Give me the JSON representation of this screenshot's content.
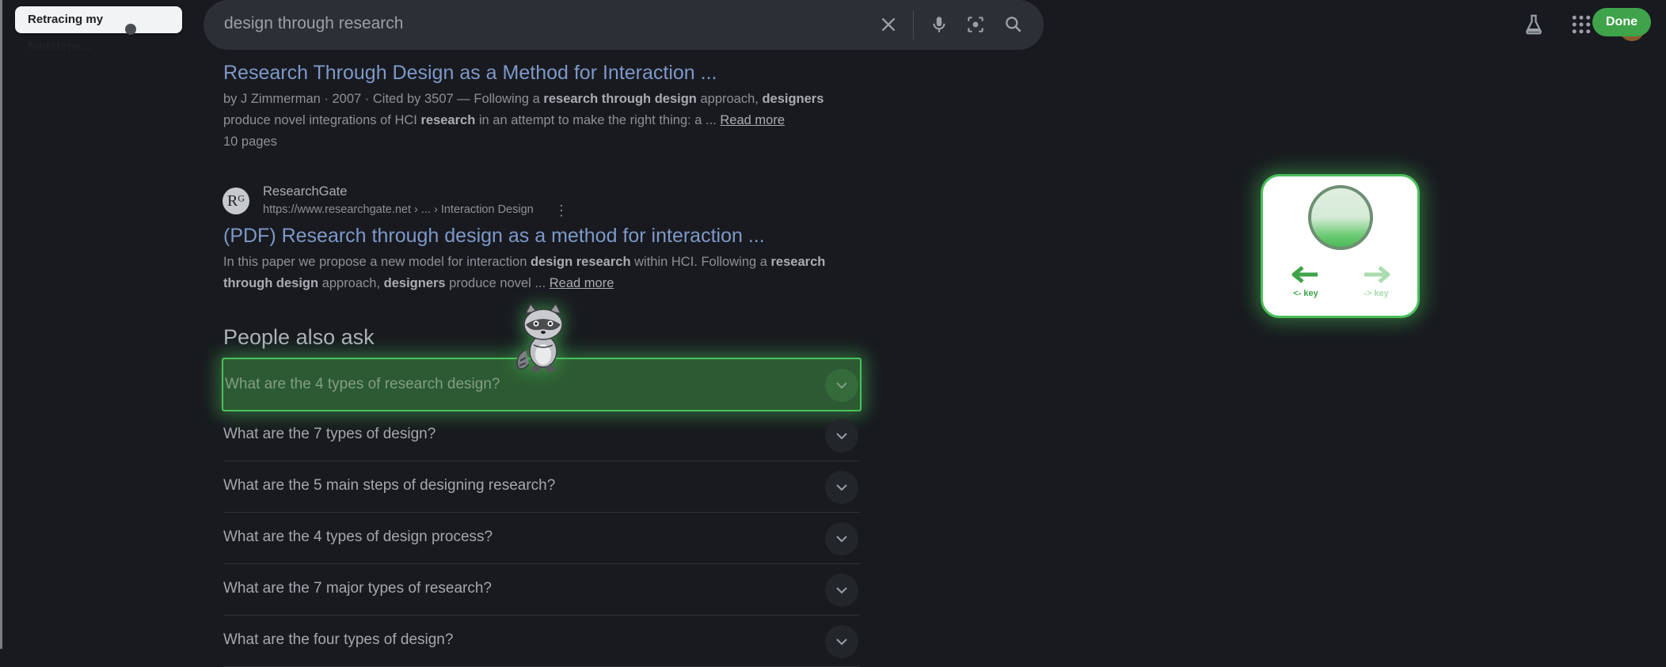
{
  "overlay": {
    "retrace_label": "Retracing my footsteps...",
    "done_label": "Done"
  },
  "search": {
    "query": "design through research",
    "clear_icon": "close-icon",
    "voice_icon": "microphone-icon",
    "lens_icon": "lens-icon",
    "search_icon": "search-icon"
  },
  "header": {
    "labs_icon": "flask-icon",
    "apps_icon": "apps-grid-icon"
  },
  "results": [
    {
      "title": "Research Through Design as a Method for Interaction ...",
      "meta": "by J Zimmerman · 2007 · Cited by 3507 — Following a ",
      "meta_b1": "research through design",
      "meta_mid": " approach, ",
      "meta_b2": "designers",
      "line2_pre": "produce novel integrations of HCI ",
      "line2_b": "research",
      "line2_post": " in an attempt to make the right thing: a ... ",
      "read_more": "Read more",
      "pages": "10 pages"
    },
    {
      "site_name": "ResearchGate",
      "favicon_text": "Rᴳ",
      "url": "https://www.researchgate.net › ... › Interaction Design",
      "menu": "⋮",
      "title": "(PDF) Research through design as a method for interaction ...",
      "line1_pre": "In this paper we propose a new model for interaction ",
      "line1_b1": "design research",
      "line1_mid": " within HCI. Following a ",
      "line1_b2": "research",
      "line2_b1": "through design",
      "line2_mid": " approach, ",
      "line2_b2": "designers",
      "line2_post": " produce novel ... ",
      "read_more": "Read more"
    }
  ],
  "people_also_ask": {
    "heading": "People also ask",
    "questions": [
      "What are the 4 types of research design?",
      "What are the 7 types of design?",
      "What are the 5 main steps of designing research?",
      "What are the 4 types of design process?",
      "What are the 7 major types of research?",
      "What are the four types of design?"
    ],
    "highlighted_index": 0
  },
  "nav_widget": {
    "back_key": "<- key",
    "forward_key": "-> key",
    "active_color": "#3fa34a",
    "inactive_color": "#a9dcae"
  }
}
